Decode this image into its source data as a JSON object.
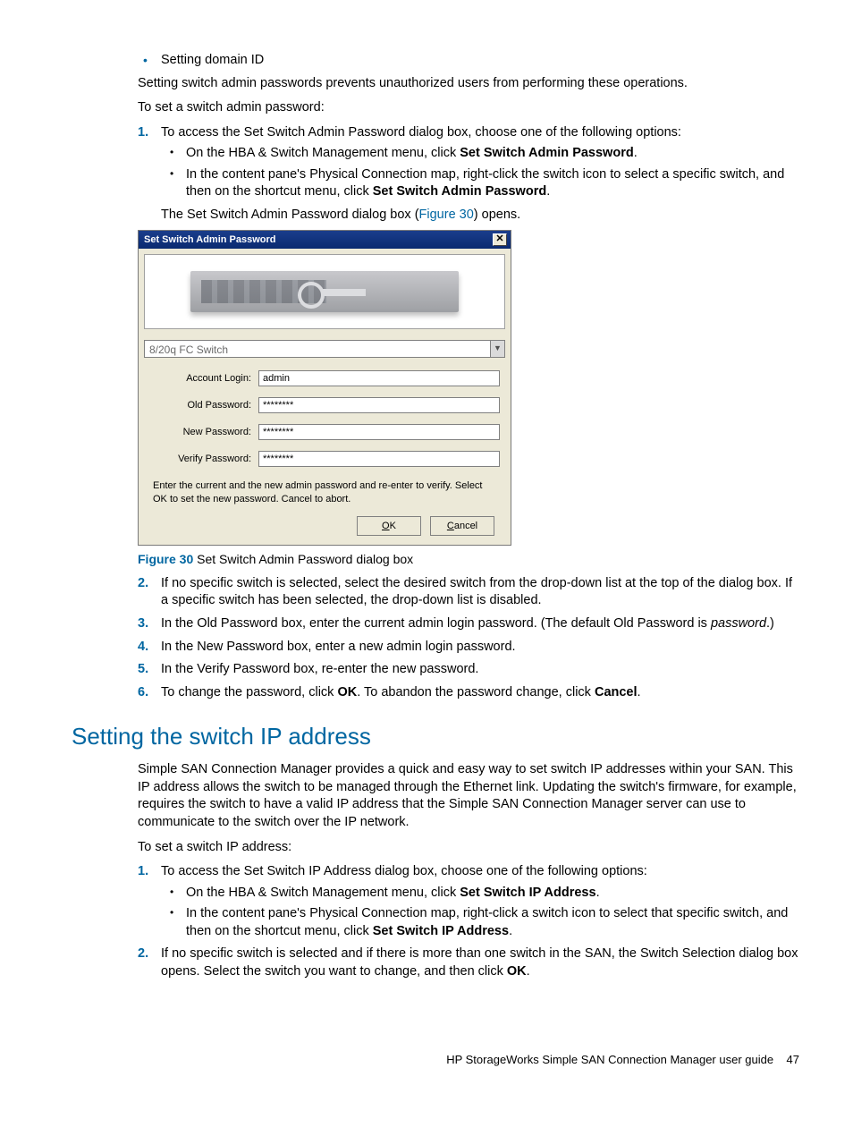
{
  "bullets_top": [
    "Setting domain ID"
  ],
  "p_prevent": "Setting switch admin passwords prevents unauthorized users from performing these operations.",
  "p_toset_pw": "To set a switch admin password:",
  "step1_intro": "To access the Set Switch Admin Password dialog box, choose one of the following options:",
  "step1_b1_pre": "On the HBA & Switch Management menu, click ",
  "step1_b1_bold": "Set Switch Admin Password",
  "step1_b1_post": ".",
  "step1_b2_pre": "In the content pane's Physical Connection map, right-click the switch icon to select a specific switch, and then on the shortcut menu, click ",
  "step1_b2_bold": "Set Switch Admin Password",
  "step1_b2_post": ".",
  "step1_after_pre": "The Set Switch Admin Password dialog box (",
  "step1_after_link": "Figure 30",
  "step1_after_post": ") opens.",
  "dialog": {
    "title": "Set Switch Admin Password",
    "dropdown": "8/20q FC Switch",
    "lbl_account": "Account Login:",
    "val_account": "admin",
    "lbl_old": "Old Password:",
    "val_old": "********",
    "lbl_new": "New Password:",
    "val_new": "********",
    "lbl_verify": "Verify Password:",
    "val_verify": "********",
    "instructions": "Enter the current and the new admin password and re-enter to verify. Select OK to set the new password. Cancel to abort.",
    "ok_u": "O",
    "ok_r": "K",
    "cancel_u": "C",
    "cancel_r": "ancel"
  },
  "fig_label": "Figure 30",
  "fig_caption": " Set Switch Admin Password dialog box",
  "step2": "If no specific switch is selected, select the desired switch from the drop-down list at the top of the dialog box. If a specific switch has been selected, the drop-down list is disabled.",
  "step3_pre": "In the Old Password box, enter the current admin login password. (The default Old Password is ",
  "step3_ital": "password",
  "step3_post": ".)",
  "step4": "In the New Password box, enter a new admin login password.",
  "step5": "In the Verify Password box, re-enter the new password.",
  "step6_pre": "To change the password, click ",
  "step6_b1": "OK",
  "step6_mid": ". To abandon the password change, click ",
  "step6_b2": "Cancel",
  "step6_post": ".",
  "h2": "Setting the switch IP address",
  "ip_p1": "Simple SAN Connection Manager provides a quick and easy way to set switch IP addresses within your SAN. This IP address allows the switch to be managed through the Ethernet link. Updating the switch's firmware, for example, requires the switch to have a valid IP address that the Simple SAN Connection Manager server can use to communicate to the switch over the IP network.",
  "ip_p2": "To set a switch IP address:",
  "ip_s1_intro": "To access the Set Switch IP Address dialog box, choose one of the following options:",
  "ip_s1_b1_pre": "On the HBA & Switch Management menu, click ",
  "ip_s1_b1_bold": "Set Switch IP Address",
  "ip_s1_b1_post": ".",
  "ip_s1_b2_pre": "In the content pane's Physical Connection map, right-click a switch icon to select that specific switch, and then on the shortcut menu, click ",
  "ip_s1_b2_bold": "Set Switch IP Address",
  "ip_s1_b2_post": ".",
  "ip_s2_pre": "If no specific switch is selected and if there is more than one switch in the SAN, the Switch Selection dialog box opens. Select the switch you want to change, and then click ",
  "ip_s2_bold": "OK",
  "ip_s2_post": ".",
  "footer_text": "HP StorageWorks Simple SAN Connection Manager user guide",
  "footer_page": "47"
}
